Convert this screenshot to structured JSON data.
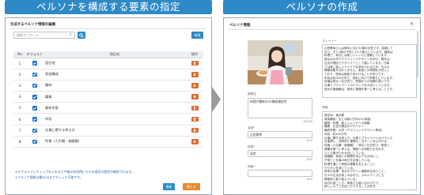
{
  "left": {
    "banner": "ペルソナを構成する要素の指定",
    "header": "生成するペルソナ情報の編集",
    "search": {
      "placeholder": "検索キーワード",
      "clear": "×"
    },
    "new_button": "新規",
    "columns": {
      "no": "No",
      "default": "デフォルト",
      "name": "項目名",
      "ops": "操作"
    },
    "rows": [
      {
        "no": "1",
        "default": true,
        "name": "居住地"
      },
      {
        "no": "2",
        "default": true,
        "name": "家族構成"
      },
      {
        "no": "3",
        "default": true,
        "name": "趣味"
      },
      {
        "no": "4",
        "default": true,
        "name": "職業"
      },
      {
        "no": "5",
        "default": true,
        "name": "最終学歴"
      },
      {
        "no": "6",
        "default": true,
        "name": "年収"
      },
      {
        "no": "7",
        "default": true,
        "name": "仕事に関する考え方"
      },
      {
        "no": "8",
        "default": true,
        "name": "性格（人生観・価値観）"
      }
    ],
    "notes": [
      "※デフォルトにチェックを入れると今後の利用時にもその項目の使用が継続されます。",
      "※ペルソナ情報は最大20までチェック可能です。"
    ],
    "update_button": "更新",
    "close_button": "閉じる"
  },
  "right": {
    "banner": "ペルソナの作成",
    "dialog_title": "ペルソナ情報",
    "close": "×",
    "fields": {
      "description_label": "説明文",
      "description_value": "料理が趣味の30歳既婚女性",
      "description_count": "13/100",
      "name_label": "名前",
      "name_value": "山田美幸",
      "name_count": "4/10",
      "gender_label": "性別",
      "gender_value": "女性",
      "gender_count": "2/10",
      "age_label": "年齢",
      "age_count": "3/10"
    },
    "story_label": "ストーリー",
    "story_lines": [
      "山田美幸さんは東京に住む30歳の女性です。結婚して",
      "おり、夫と2歳の子供と3人で暮らしています。趣味は",
      "料理で、休日には新しいレシピに挑戦しています。",
      "彼女は大学でグラフィックデザインを学び、現在は",
      "広告代理店でデザイナーとして働いています。仕事",
      "では常に新しいアイデアを求められるため、日々の",
      "情報収集を欠かしません。家族との時間を大切にし",
      "ており、週末は家族で出かけることが多いです。",
      "年収は約500万円で、将来に向けて貯蓄もしています。",
      "性格は明るく社交的で、周囲からの信頼も厚いです。",
      "仕事とプライベートのバランスを大切にしています。",
      "彼女の価値観は、家族と健康を第一に考えることです。"
    ],
    "detail_label": "詳細",
    "detail_lines": [
      "居住地：東京都",
      "家族構成：夫と2歳の子供の3人家族",
      "趣味：料理、新しいレシピへの挑戦",
      "職業：広告代理店のデザイナー",
      "最終学歴：大学（グラフィックデザイン専攻）",
      "年収：約500万円",
      "仕事に関する考え方：仕事とプライベートのバランス",
      "を重視し、効率的に業務をこなすことを心がける",
      "性格（人生観・価値観）：明るく社交的で、家族と",
      "健康を第一に考える。周囲への気配りを忘れず、",
      "人との繋がりを大切にしている。",
      "価値観：家族との時間を何よりも大切にし、",
      "子育てと仕事の両立を目指している。",
      "料理を通じて家族の健康を支えることに",
      "やりがいを感じている。",
      "将来の目標：自分のデザイン事務所を持つこと。",
      "日々の生活を楽しみながら、スキルアップにも",
      "積極的に取り組んでいる。",
      "休日の過ごし方：家族で公園へ出かけたり、",
      "新しいカフェを巡ったりすることが好き。"
    ]
  }
}
